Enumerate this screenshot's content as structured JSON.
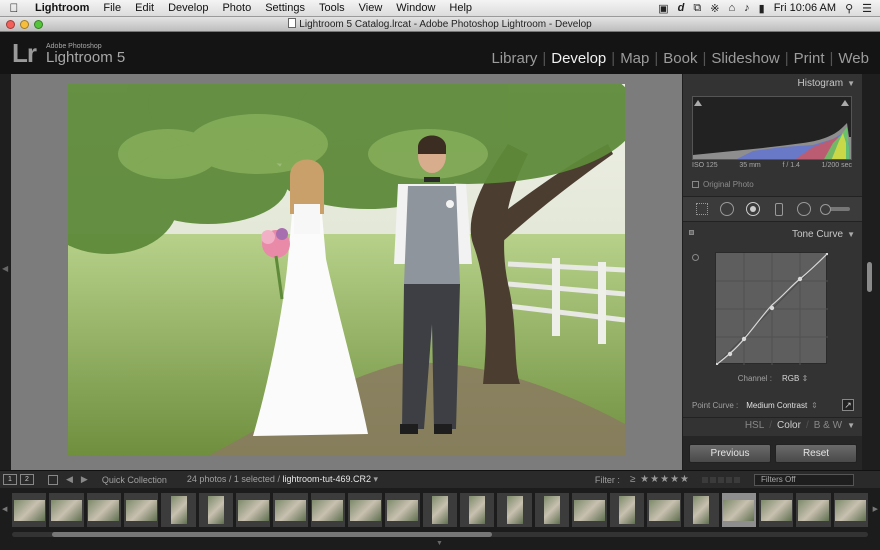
{
  "menubar": {
    "apple_icon": "apple-icon",
    "items": [
      "Lightroom",
      "File",
      "Edit",
      "Develop",
      "Photo",
      "Settings",
      "Tools",
      "View",
      "Window",
      "Help"
    ],
    "clock": "Fri 10:06 AM"
  },
  "window": {
    "title": "Lightroom 5 Catalog.lrcat - Adobe Photoshop Lightroom - Develop"
  },
  "header": {
    "logo": "Lr",
    "brand_small": "Adobe Photoshop",
    "brand_big": "Lightroom 5",
    "modules": [
      "Library",
      "Develop",
      "Map",
      "Book",
      "Slideshow",
      "Print",
      "Web"
    ],
    "active_module": "Develop"
  },
  "histogram": {
    "title": "Histogram",
    "iso": "ISO 125",
    "focal": "35 mm",
    "aperture": "f / 1.4",
    "shutter": "1/200 sec",
    "original_photo": "Original Photo"
  },
  "tone_curve": {
    "title": "Tone Curve",
    "channel_label": "Channel :",
    "channel_value": "RGB",
    "point_curve_label": "Point Curve :",
    "point_curve_value": "Medium Contrast"
  },
  "hsl": {
    "hsl": "HSL",
    "color": "Color",
    "bw": "B & W"
  },
  "buttons": {
    "previous": "Previous",
    "reset": "Reset"
  },
  "filmstrip_bar": {
    "page1": "1",
    "page2": "2",
    "source": "Quick Collection",
    "count": "24 photos / 1 selected /",
    "filename": "lightroom-tut-469.CR2",
    "filter_label": "Filter :",
    "stars": "≥ ★★★★★",
    "filters_off": "Filters Off"
  },
  "colors": {
    "accent": "#f0f0f0",
    "panel": "#333333",
    "canvas": "#7c7c7c"
  }
}
